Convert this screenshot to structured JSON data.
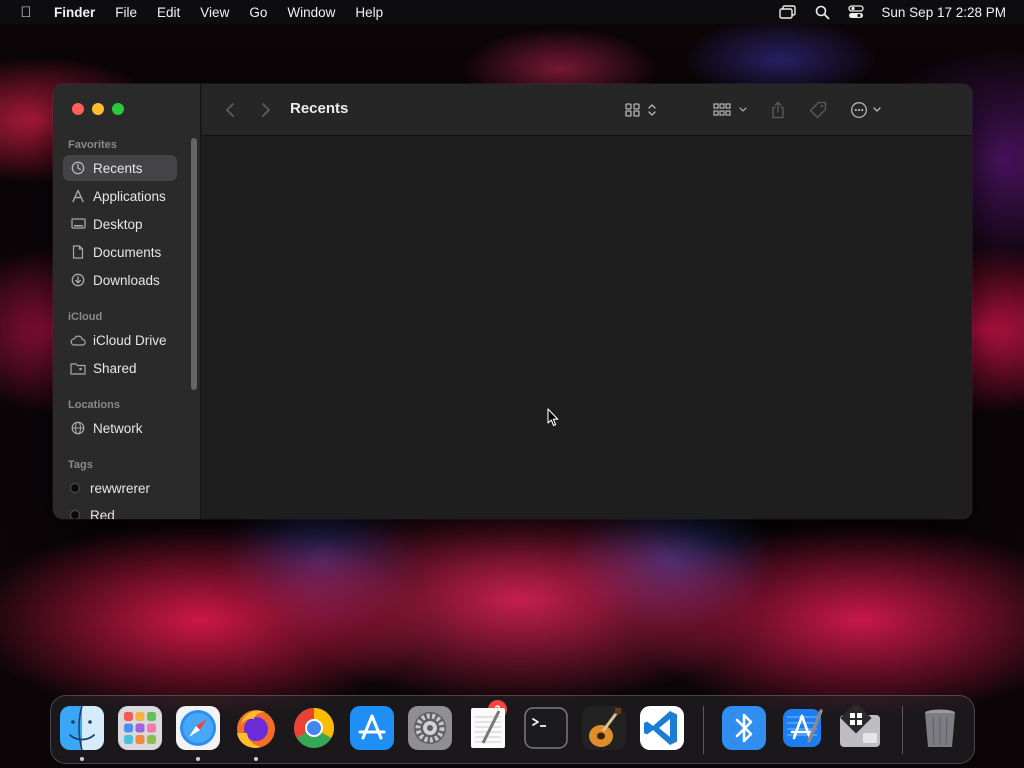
{
  "menubar": {
    "app_name": "Finder",
    "menus": [
      "File",
      "Edit",
      "View",
      "Go",
      "Window",
      "Help"
    ],
    "clock": "Sun Sep 17  2:28 PM",
    "status_icons": [
      "screen-mirroring-icon",
      "spotlight-search-icon",
      "control-center-icon"
    ]
  },
  "finder": {
    "title": "Recents",
    "sidebar": {
      "favorites_header": "Favorites",
      "favorites": [
        {
          "label": "Recents",
          "icon": "clock-icon",
          "selected": true
        },
        {
          "label": "Applications",
          "icon": "applications-icon"
        },
        {
          "label": "Desktop",
          "icon": "desktop-icon"
        },
        {
          "label": "Documents",
          "icon": "document-icon"
        },
        {
          "label": "Downloads",
          "icon": "download-icon"
        }
      ],
      "icloud_header": "iCloud",
      "icloud": [
        {
          "label": "iCloud Drive",
          "icon": "cloud-icon"
        },
        {
          "label": "Shared",
          "icon": "shared-folder-icon"
        }
      ],
      "locations_header": "Locations",
      "locations": [
        {
          "label": "Network",
          "icon": "globe-icon"
        }
      ],
      "tags_header": "Tags",
      "tags": [
        {
          "label": "rewwrerer",
          "color": "#0a0a0a"
        },
        {
          "label": "Red",
          "color": "#0a0a0a"
        }
      ]
    }
  },
  "dock": {
    "apps": [
      "Finder",
      "Launchpad",
      "Safari",
      "Firefox",
      "Google Chrome",
      "App Store",
      "System Settings",
      "TextEdit",
      "Terminal",
      "GarageBand",
      "Visual Studio Code",
      "Bluetooth File Exchange",
      "Xcode",
      "Boot Camp Assistant",
      "Trash"
    ],
    "settings_badge": "2"
  },
  "colors": {
    "close": "#fe5f57",
    "minimize": "#febc2e",
    "zoom": "#28c840",
    "sidebar": "#2a2a2b",
    "content": "#1e1e1e",
    "badge": "#f2473c"
  }
}
